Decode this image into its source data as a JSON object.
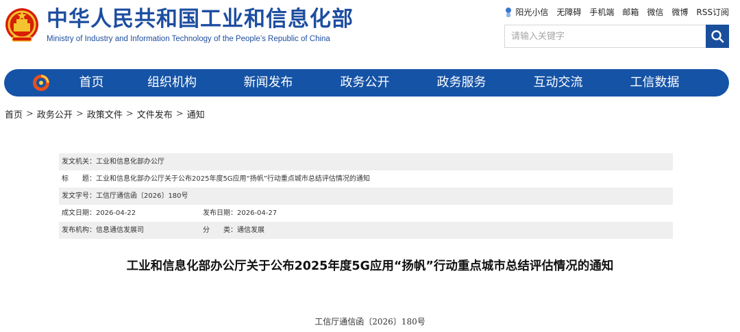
{
  "header": {
    "title_cn": "中华人民共和国工业和信息化部",
    "title_en": "Ministry of Industry and Information Technology of the People’s Republic of China",
    "emblem_icon": "national-emblem-icon",
    "top_links": [
      "阳光小信",
      "无障碍",
      "手机端",
      "邮箱",
      "微信",
      "微博",
      "RSS订阅"
    ],
    "search": {
      "placeholder": "请输入关键字"
    }
  },
  "nav": {
    "logo_icon": "miit-logo-icon",
    "items": [
      "首页",
      "组织机构",
      "新闻发布",
      "政务公开",
      "政务服务",
      "互动交流",
      "工信数据"
    ]
  },
  "breadcrumb": [
    "首页",
    "政务公开",
    "政策文件",
    "文件发布",
    "通知"
  ],
  "breadcrumb_separator": ">",
  "info": {
    "issuer_label": "发文机关：",
    "issuer": "工业和信息化部办公厅",
    "title_label": "标　　题：",
    "title": "工业和信息化部办公厅关于公布2025年度5G应用“扬帆”行动重点城市总结评估情况的通知",
    "docno_label": "发文字号：",
    "docno": "工信厅通信函〔2026〕180号",
    "written_label": "成文日期：",
    "written": "2026-04-22",
    "published_label": "发布日期：",
    "published": "2026-04-27",
    "org_label": "发布机构：",
    "org": "信息通信发展司",
    "category_label": "分　　类：",
    "category": "通信发展"
  },
  "article": {
    "title": "工业和信息化部办公厅关于公布2025年度5G应用“扬帆”行动重点城市总结评估情况的通知",
    "docno": "工信厅通信函〔2026〕180号"
  },
  "colors": {
    "brand_blue": "#1553a6",
    "title_blue": "#1d4ea0",
    "row_shade": "#efefef"
  }
}
